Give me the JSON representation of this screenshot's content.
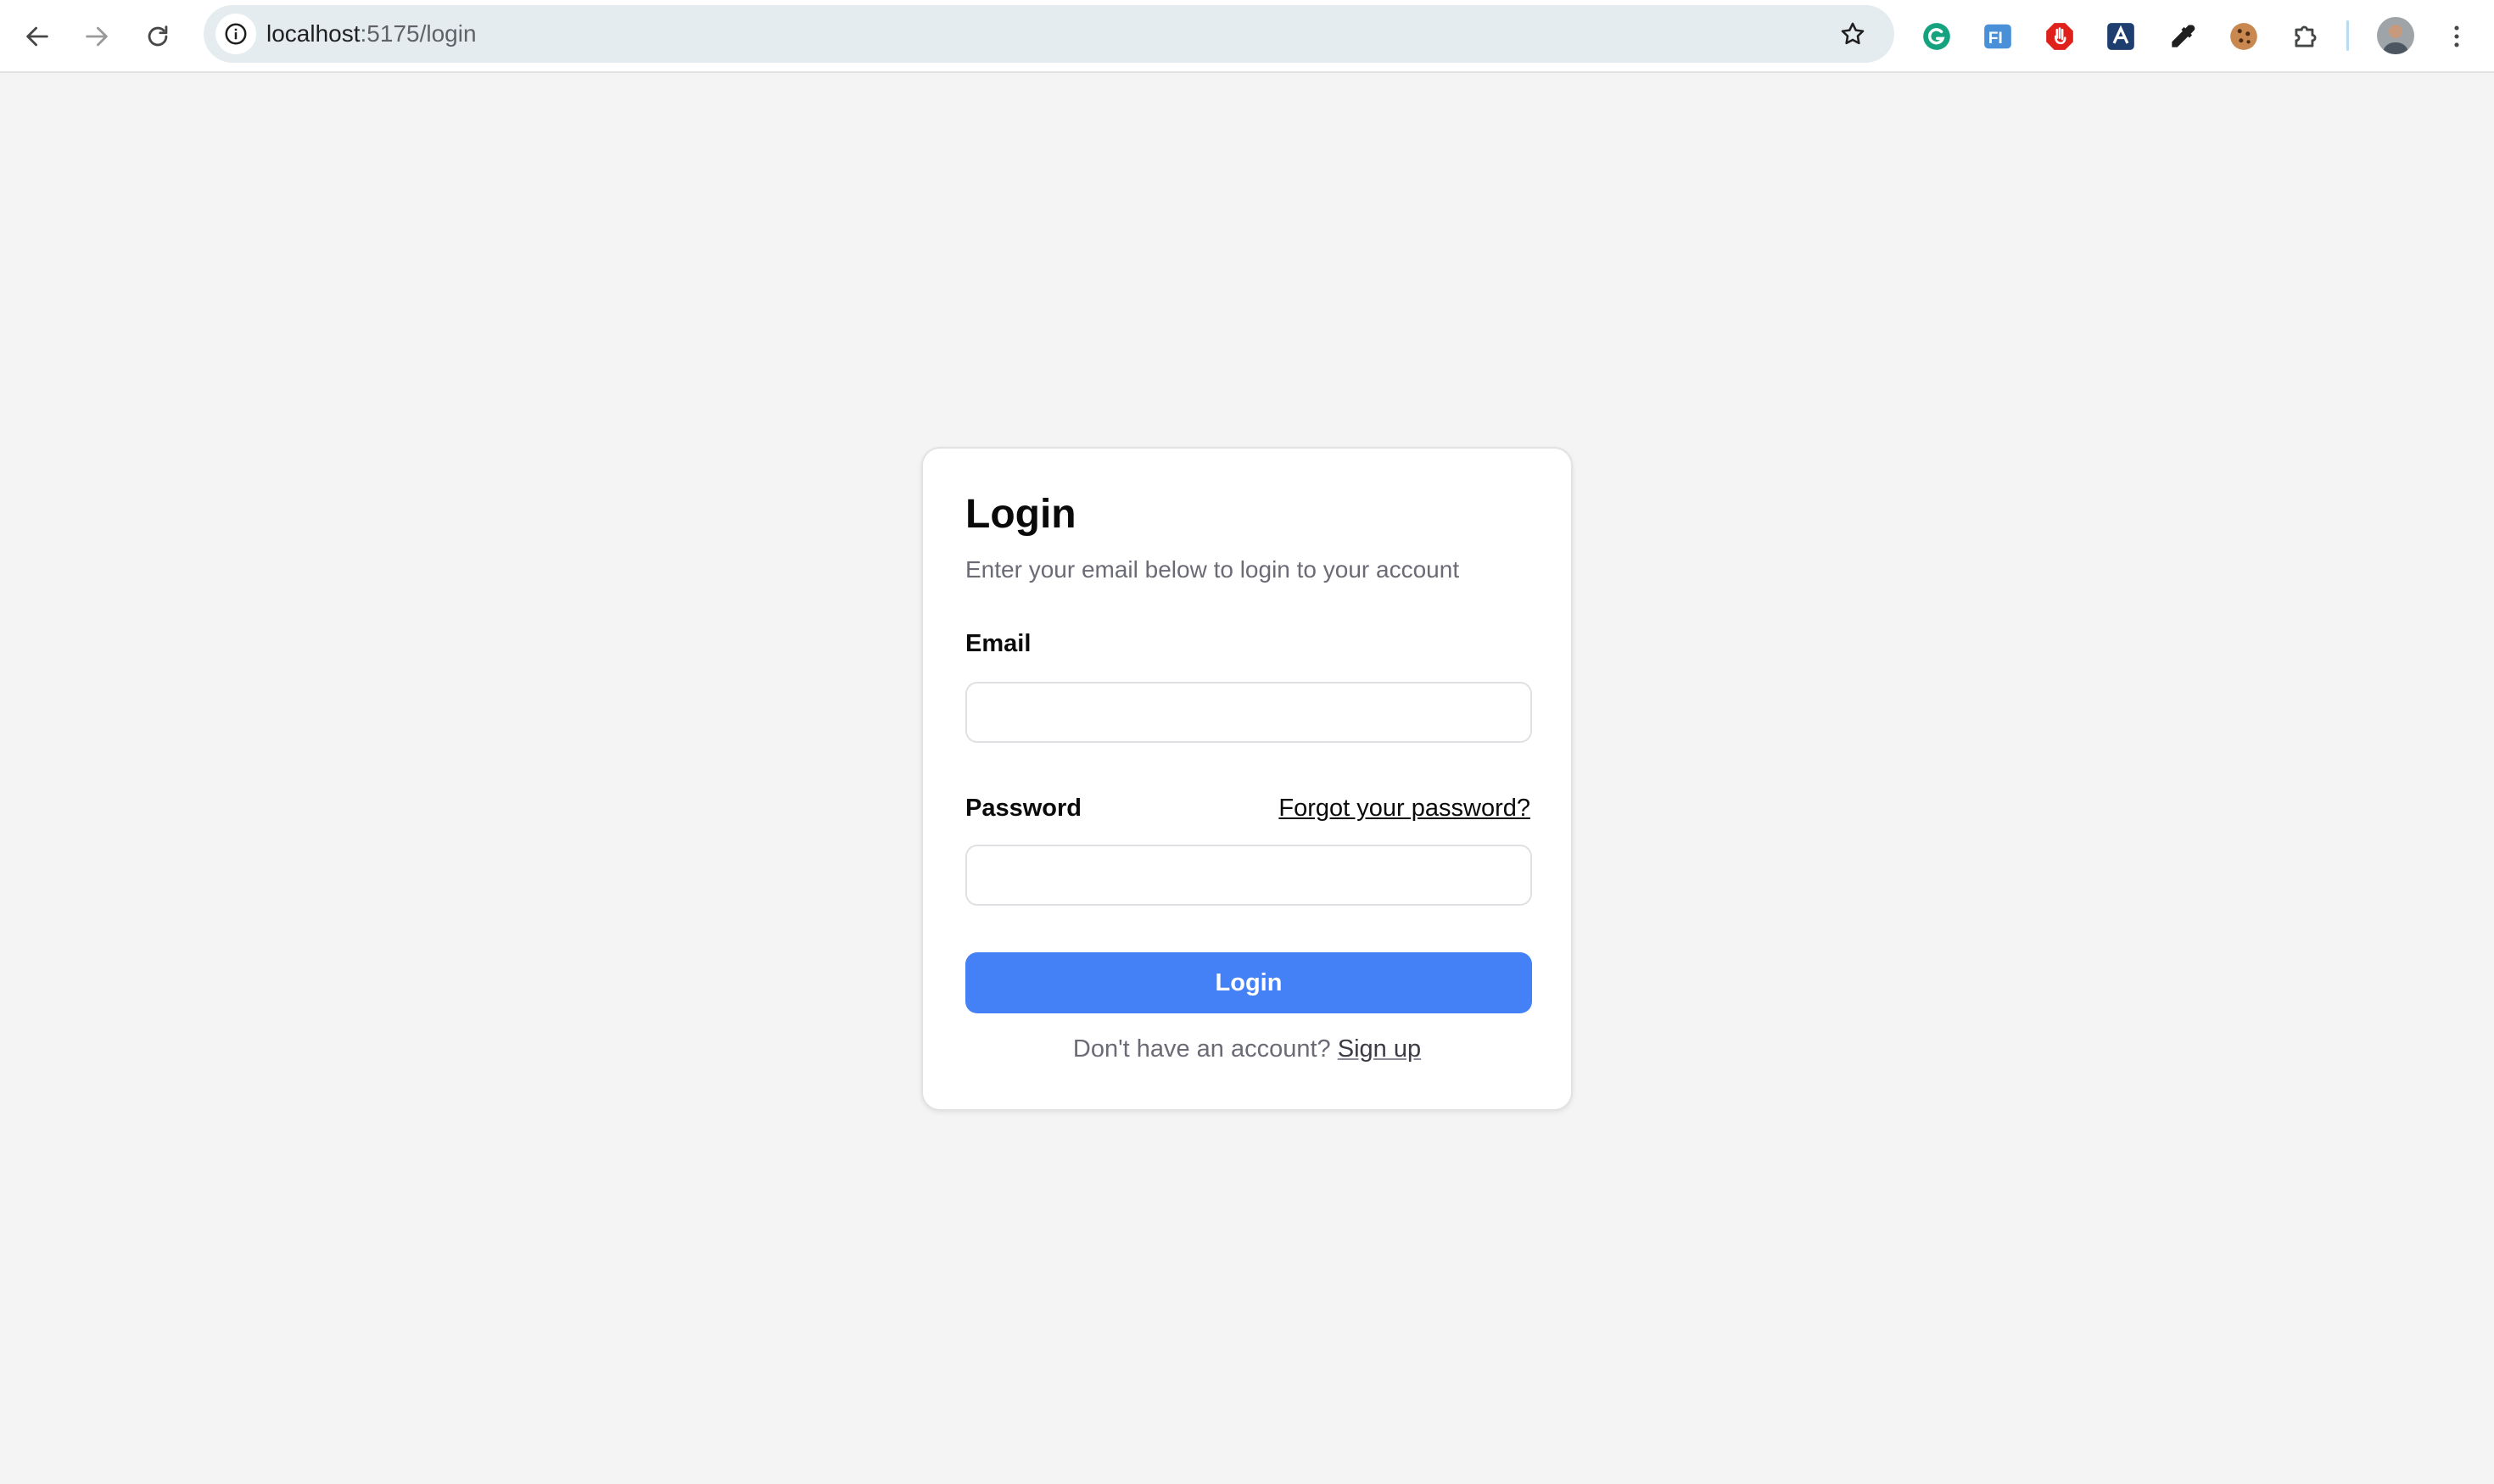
{
  "browser": {
    "url_host": "localhost",
    "url_path": ":5175/login",
    "colors": {
      "toolbar": "#ffffff",
      "omnibox": "#e5ecf0"
    },
    "extensions": [
      {
        "name": "grammarly-icon",
        "color": "#15c39a"
      },
      {
        "name": "fi-icon",
        "color": "#4a90d9"
      },
      {
        "name": "adblock-icon",
        "color": "#e0201b"
      },
      {
        "name": "extension-a-icon",
        "color": "#1d3e6e"
      },
      {
        "name": "eyedropper-icon",
        "color": "#1f1f1f"
      },
      {
        "name": "cookie-icon",
        "color": "#a0612f"
      },
      {
        "name": "puzzle-icon",
        "color": "#444746"
      }
    ]
  },
  "login": {
    "title": "Login",
    "subtitle": "Enter your email below to login to your account",
    "email_label": "Email",
    "email_value": "",
    "email_placeholder": "",
    "password_label": "Password",
    "password_value": "",
    "password_placeholder": "",
    "forgot_label": "Forgot your password?",
    "submit_label": "Login",
    "footer_text": "Don't have an account? ",
    "signup_label": "Sign up",
    "colors": {
      "primary": "#4480f6",
      "muted_text": "#6b6b76",
      "background": "#f4f4f4"
    }
  }
}
